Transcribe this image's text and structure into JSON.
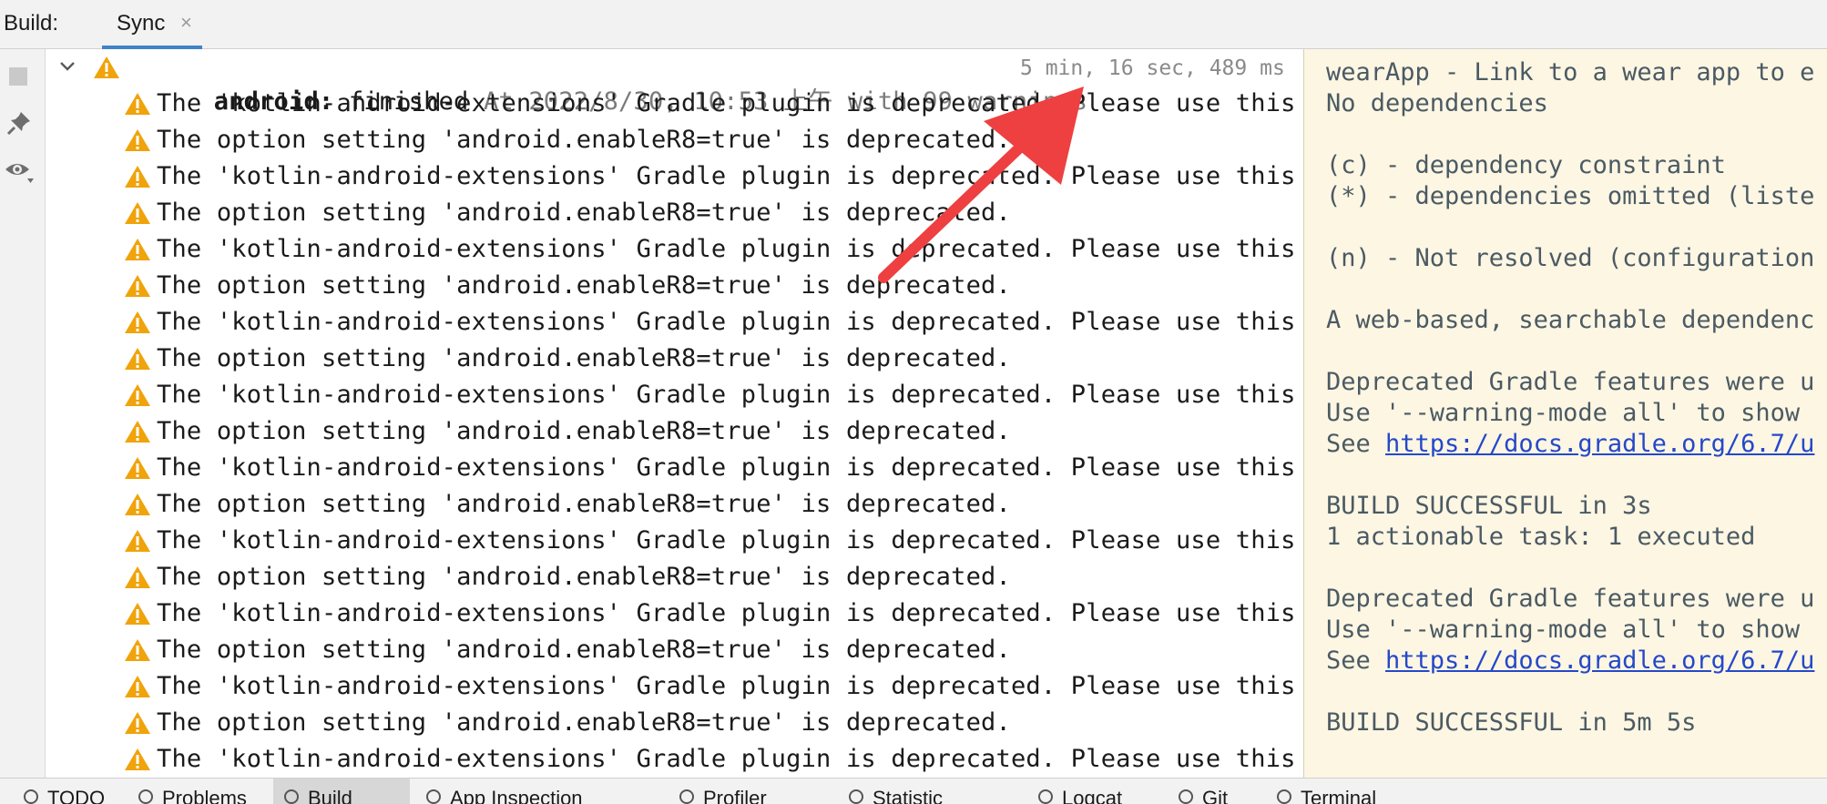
{
  "topbar": {
    "build_label": "Build:",
    "sync_tab": "Sync",
    "close_glyph": "×"
  },
  "tree": {
    "root": {
      "name": "android:",
      "status": " finished",
      "meta": " At 2022/8/30, 10:53 上午 with 99 warnings",
      "duration": "5 min, 16 sec, 489 ms"
    },
    "warnings": [
      "The 'kotlin-android-extensions' Gradle plugin is deprecated. Please use this migr",
      "The option setting 'android.enableR8=true' is deprecated.",
      "The 'kotlin-android-extensions' Gradle plugin is deprecated. Please use this migr",
      "The option setting 'android.enableR8=true' is deprecated.",
      "The 'kotlin-android-extensions' Gradle plugin is deprecated. Please use this migr",
      "The option setting 'android.enableR8=true' is deprecated.",
      "The 'kotlin-android-extensions' Gradle plugin is deprecated. Please use this migr",
      "The option setting 'android.enableR8=true' is deprecated.",
      "The 'kotlin-android-extensions' Gradle plugin is deprecated. Please use this migr",
      "The option setting 'android.enableR8=true' is deprecated.",
      "The 'kotlin-android-extensions' Gradle plugin is deprecated. Please use this migr",
      "The option setting 'android.enableR8=true' is deprecated.",
      "The 'kotlin-android-extensions' Gradle plugin is deprecated. Please use this migr",
      "The option setting 'android.enableR8=true' is deprecated.",
      "The 'kotlin-android-extensions' Gradle plugin is deprecated. Please use this migr",
      "The option setting 'android.enableR8=true' is deprecated.",
      "The 'kotlin-android-extensions' Gradle plugin is deprecated. Please use this migr",
      "The option setting 'android.enableR8=true' is deprecated.",
      "The 'kotlin-android-extensions' Gradle plugin is deprecated. Please use this migr"
    ]
  },
  "console": {
    "lines": [
      {
        "text": "wearApp - Link to a wear app to e"
      },
      {
        "text": "No dependencies"
      },
      {
        "text": ""
      },
      {
        "text": "(c) - dependency constraint"
      },
      {
        "text": "(*) - dependencies omitted (liste"
      },
      {
        "text": ""
      },
      {
        "text": "(n) - Not resolved (configuration"
      },
      {
        "text": ""
      },
      {
        "text": "A web-based, searchable dependenc"
      },
      {
        "text": ""
      },
      {
        "text": "Deprecated Gradle features were u"
      },
      {
        "text": "Use '--warning-mode all' to show"
      },
      {
        "text": "See ",
        "link": "https://docs.gradle.org/6.7/u"
      },
      {
        "text": ""
      },
      {
        "text": "BUILD SUCCESSFUL in 3s"
      },
      {
        "text": "1 actionable task: 1 executed"
      },
      {
        "text": ""
      },
      {
        "text": "Deprecated Gradle features were u"
      },
      {
        "text": "Use '--warning-mode all' to show"
      },
      {
        "text": "See ",
        "link": "https://docs.gradle.org/6.7/u"
      },
      {
        "text": ""
      },
      {
        "text": "BUILD SUCCESSFUL in 5m 5s"
      }
    ]
  },
  "bottombar": {
    "tabs": [
      {
        "label": "TODO",
        "icon": "list-icon"
      },
      {
        "label": "Problems",
        "icon": "info-icon"
      },
      {
        "label": "Build",
        "icon": "hammer-icon",
        "active": true
      },
      {
        "label": "App Inspection",
        "icon": "inspect-icon"
      },
      {
        "label": "Profiler",
        "icon": "gauge-icon"
      },
      {
        "label": "Statistic",
        "icon": "pie-icon"
      },
      {
        "label": "Logcat",
        "icon": "logcat-icon"
      },
      {
        "label": "Git",
        "icon": "branch-icon"
      },
      {
        "label": "Terminal",
        "icon": "terminal-icon"
      }
    ]
  },
  "colors": {
    "warning": "#f0a30a",
    "console_bg": "#fcf6e3",
    "arrow": "#ee4040",
    "link": "#2548c9"
  }
}
